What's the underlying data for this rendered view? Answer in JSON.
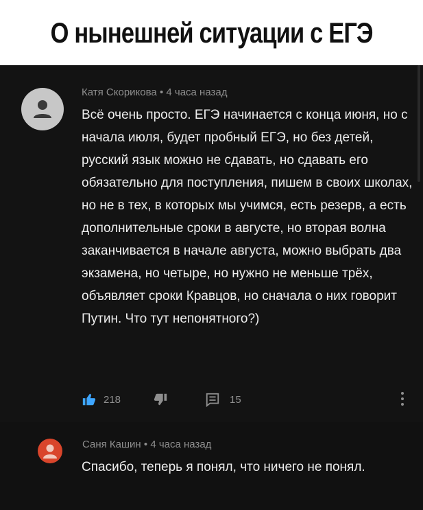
{
  "header": {
    "title": "О нынешней ситуации с ЕГЭ"
  },
  "comments": [
    {
      "author": "Катя Скорикова",
      "separator": "•",
      "time": "4 часа назад",
      "text": "Всё очень просто. ЕГЭ начинается с конца июня, но с начала июля, будет пробный ЕГЭ, но без детей, русский язык можно не сдавать, но сдавать его обязательно для поступления, пишем в своих школах, но не в тех, в которых мы учимся, есть резерв, а есть дополнительные сроки в августе, но вторая волна заканчивается в начале августа, можно выбрать два экзамена, но четыре, но нужно не меньше трёх, объявляет сроки Кравцов, но сначала о них говорит Путин. Что тут непонятного?)",
      "likes": "218",
      "replies": "15",
      "like_icon": "thumbs-up-icon",
      "dislike_icon": "thumbs-down-icon",
      "reply_icon": "reply-icon",
      "accent": "#3ea6ff"
    },
    {
      "author": "Саня Кашин",
      "separator": "•",
      "time": "4 часа назад",
      "text": "Спасибо, теперь я понял, что ничего не понял."
    }
  ]
}
